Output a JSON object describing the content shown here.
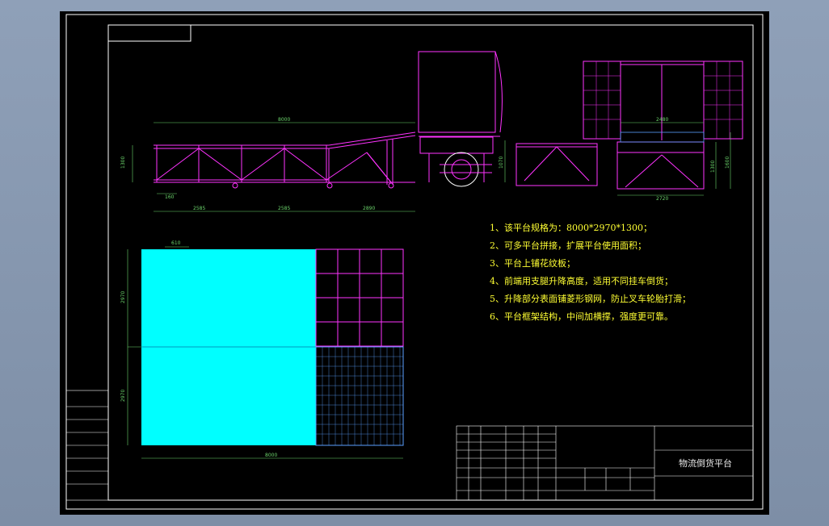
{
  "drawing": {
    "dimensions": {
      "top_length": "8000",
      "seg1": "2585",
      "seg2": "2585",
      "seg3": "2890",
      "height_left": "1300",
      "offset_small": "160",
      "ramp_height": "1070",
      "side_width": "2480",
      "side_height": "1300",
      "side_height2": "1600",
      "bottom_width": "2720",
      "plan_offset": "610",
      "plan_width_top": "2970",
      "plan_width_bottom": "2970",
      "plan_length": "8000"
    },
    "notes": [
      "1、该平台规格为：8000*2970*1300；",
      "2、可多平台拼接，扩展平台使用面积；",
      "3、平台上铺花纹板；",
      "4、前端用支腿升降高度，适用不同挂车倒货；",
      "5、升降部分表面铺菱形钢网，防止叉车轮胎打滑；",
      "6、平台框架结构，中间加横撑，强度更可靠。"
    ],
    "title_block": {
      "drawing_title": "物流倒货平台"
    }
  },
  "colors": {
    "background": "#000000",
    "frame": "#ffffff",
    "structure": "#ff33ff",
    "dimension": "#6cd66c",
    "plan_fill": "#00ffff",
    "notes": "#ffff33",
    "mesh": "#5aa0ff"
  }
}
